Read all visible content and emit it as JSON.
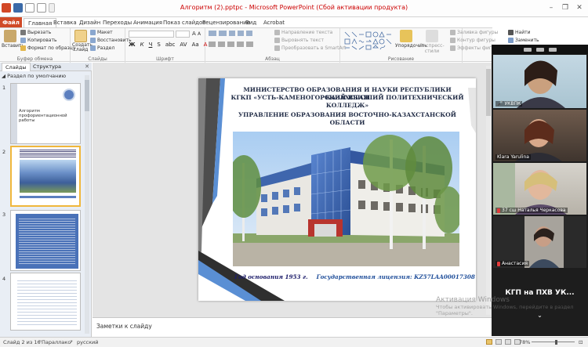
{
  "window": {
    "title": "Алгоритм (2).pptx [Режим совместимости] - Microsoft PowerPoint (Сбой активации продукта)",
    "title_short": "Алгоритм (2).pptpc - Microsoft PowerPoint (Сбой активации продукта)"
  },
  "tabs": {
    "file": "Файл",
    "items": [
      "Главная",
      "Вставка",
      "Дизайн",
      "Переходы",
      "Анимация",
      "Показ слайдов",
      "Рецензирование",
      "Вид",
      "Acrobat"
    ]
  },
  "ribbon": {
    "clipboard": {
      "paste": "Вставить",
      "cut": "Вырезать",
      "copy": "Копировать",
      "format_painter": "Формат по образцу",
      "label": "Буфер обмена"
    },
    "slides": {
      "new_slide": "Создать слайд",
      "layout": "Макет",
      "reset": "Восстановить",
      "section": "Раздел",
      "label": "Слайды"
    },
    "font": {
      "label": "Шрифт"
    },
    "paragraph": {
      "direction": "Направление текста",
      "align": "Выровнять текст",
      "smartart": "Преобразовать в SmartArt",
      "label": "Абзац"
    },
    "drawing": {
      "arrange": "Упорядочить",
      "quick_styles": "Экспресс-стили",
      "fill": "Заливка фигуры",
      "outline": "Контур фигуры",
      "effects": "Эффекты фигур",
      "label": "Рисование"
    },
    "editing": {
      "find": "Найти",
      "replace": "Заменить"
    }
  },
  "left_panel": {
    "tab_slides": "Слайды",
    "tab_outline": "Структура",
    "section_title": "Раздел по умолчанию",
    "slides": [
      {
        "num": "1",
        "title": "Алгоритм профориентационной работы"
      },
      {
        "num": "2",
        "title": ""
      },
      {
        "num": "3",
        "title": ""
      },
      {
        "num": "4",
        "title": ""
      }
    ]
  },
  "slide": {
    "line1": "МИНИСТЕРСТВО ОБРАЗОВАНИЯ И НАУКИ РЕСПУБЛИКИ КАЗАХСТАН",
    "line2": "КГКП «УСТЬ-КАМЕНОГОРСКИЙ ВЫСШИЙ ПОЛИТЕХНИЧЕСКИЙ",
    "line3": "КОЛЛЕДЖ»",
    "line4": "УПРАВЛЕНИЕ ОБРАЗОВАНИЯ ВОСТОЧНО-КАЗАХСТАНСКОЙ ОБЛАСТИ",
    "founded": "Год основания 1953 г.",
    "license": "Государственная лицензия: KZ57LAA00017308 от 04.12.2019г."
  },
  "notes": {
    "placeholder": "Заметки к слайду"
  },
  "status": {
    "slide_info": "Слайд 2 из 16",
    "theme": "\"Параллакс\"",
    "language": "русский",
    "zoom": "78%"
  },
  "video_panel": {
    "participants": [
      {
        "name": "УКВПК",
        "muted": false
      },
      {
        "name": "Klara Yarulina",
        "muted": false
      },
      {
        "name": "37 сш  Наталья Черкасова",
        "muted": true
      },
      {
        "name": "Анастасия",
        "muted": true
      }
    ],
    "meeting_title": "КГП на ПХВ УК...",
    "chevron": "⌄"
  },
  "activation": {
    "line1": "Активация Windows",
    "line2": "Чтобы активировать Windows, перейдите в раздел",
    "line3": "\"Параметры\"."
  },
  "colors": {
    "file_tab": "#d04a27",
    "slide_blue": "#1f4e9a",
    "title_red": "#cc0000"
  }
}
